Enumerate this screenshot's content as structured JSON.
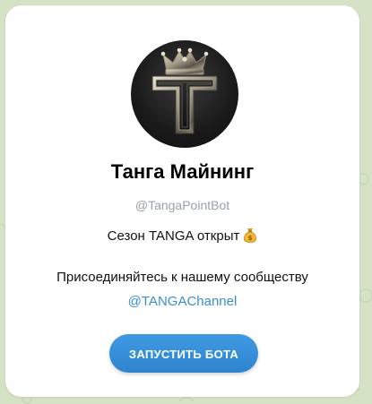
{
  "bot": {
    "name": "Танга Майнинг",
    "username": "@TangaPointBot",
    "season_text": "Сезон TANGA открыт",
    "season_icon": "money-bag-icon",
    "join_text": "Присоединяйтесь к нашему сообществу",
    "channel_link": "@TANGAChannel",
    "start_button_label": "ЗАПУСТИТЬ БОТА"
  },
  "colors": {
    "accent": "#3a8ed4",
    "button": "#3290d9",
    "background": "#d7e3c9"
  }
}
